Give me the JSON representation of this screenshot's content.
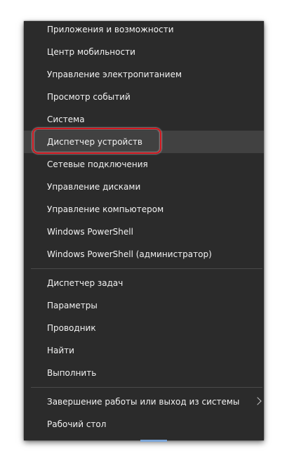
{
  "menu": {
    "items": [
      {
        "label": "Приложения и возможности"
      },
      {
        "label": "Центр мобильности"
      },
      {
        "label": "Управление электропитанием"
      },
      {
        "label": "Просмотр событий"
      },
      {
        "label": "Система"
      },
      {
        "label": "Диспетчер устройств"
      },
      {
        "label": "Сетевые подключения"
      },
      {
        "label": "Управление дисками"
      },
      {
        "label": "Управление компьютером"
      },
      {
        "label": "Windows PowerShell"
      },
      {
        "label": "Windows PowerShell (администратор)"
      },
      {
        "label": "Диспетчер задач"
      },
      {
        "label": "Параметры"
      },
      {
        "label": "Проводник"
      },
      {
        "label": "Найти"
      },
      {
        "label": "Выполнить"
      },
      {
        "label": "Завершение работы или выход из системы",
        "submenu_icon": "chevron-right-icon"
      },
      {
        "label": "Рабочий стол"
      }
    ],
    "highlighted_item": "Диспетчер устройств"
  },
  "colors": {
    "menu_background": "#2b2b2b",
    "menu_text": "#f2f2f2",
    "hover_background": "#414141",
    "separator": "#4a4a4a",
    "annotation_ring": "#d3161e"
  }
}
